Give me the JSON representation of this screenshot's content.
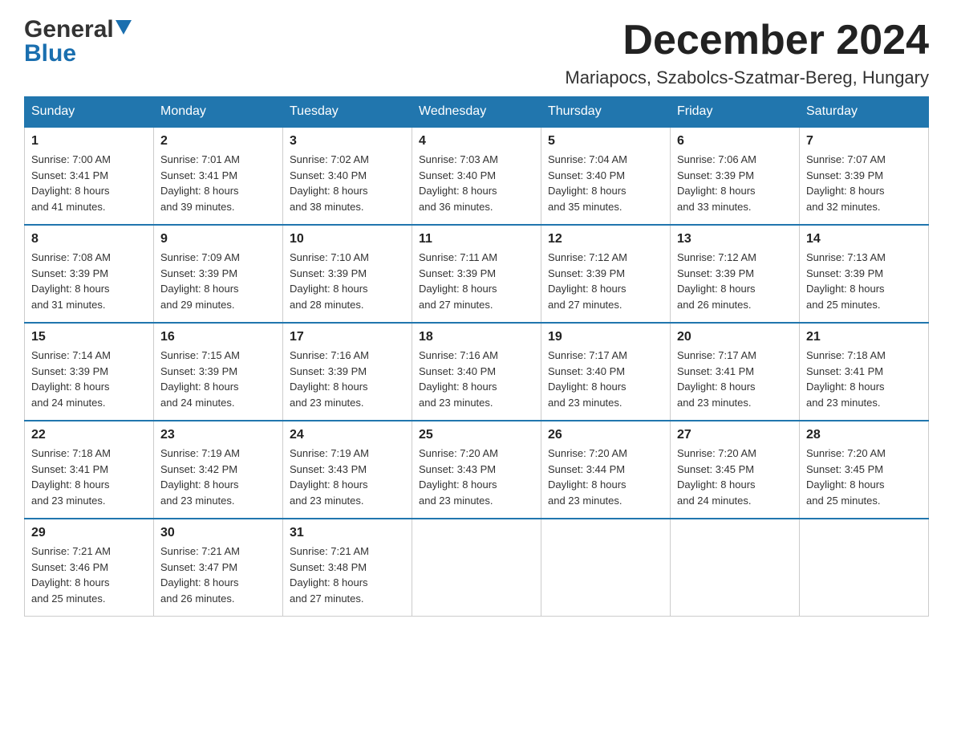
{
  "header": {
    "logo_general": "General",
    "logo_blue": "Blue",
    "month_title": "December 2024",
    "location": "Mariapocs, Szabolcs-Szatmar-Bereg, Hungary"
  },
  "days_of_week": [
    "Sunday",
    "Monday",
    "Tuesday",
    "Wednesday",
    "Thursday",
    "Friday",
    "Saturday"
  ],
  "weeks": [
    [
      {
        "day": "1",
        "sunrise": "7:00 AM",
        "sunset": "3:41 PM",
        "daylight": "8 hours and 41 minutes."
      },
      {
        "day": "2",
        "sunrise": "7:01 AM",
        "sunset": "3:41 PM",
        "daylight": "8 hours and 39 minutes."
      },
      {
        "day": "3",
        "sunrise": "7:02 AM",
        "sunset": "3:40 PM",
        "daylight": "8 hours and 38 minutes."
      },
      {
        "day": "4",
        "sunrise": "7:03 AM",
        "sunset": "3:40 PM",
        "daylight": "8 hours and 36 minutes."
      },
      {
        "day": "5",
        "sunrise": "7:04 AM",
        "sunset": "3:40 PM",
        "daylight": "8 hours and 35 minutes."
      },
      {
        "day": "6",
        "sunrise": "7:06 AM",
        "sunset": "3:39 PM",
        "daylight": "8 hours and 33 minutes."
      },
      {
        "day": "7",
        "sunrise": "7:07 AM",
        "sunset": "3:39 PM",
        "daylight": "8 hours and 32 minutes."
      }
    ],
    [
      {
        "day": "8",
        "sunrise": "7:08 AM",
        "sunset": "3:39 PM",
        "daylight": "8 hours and 31 minutes."
      },
      {
        "day": "9",
        "sunrise": "7:09 AM",
        "sunset": "3:39 PM",
        "daylight": "8 hours and 29 minutes."
      },
      {
        "day": "10",
        "sunrise": "7:10 AM",
        "sunset": "3:39 PM",
        "daylight": "8 hours and 28 minutes."
      },
      {
        "day": "11",
        "sunrise": "7:11 AM",
        "sunset": "3:39 PM",
        "daylight": "8 hours and 27 minutes."
      },
      {
        "day": "12",
        "sunrise": "7:12 AM",
        "sunset": "3:39 PM",
        "daylight": "8 hours and 27 minutes."
      },
      {
        "day": "13",
        "sunrise": "7:12 AM",
        "sunset": "3:39 PM",
        "daylight": "8 hours and 26 minutes."
      },
      {
        "day": "14",
        "sunrise": "7:13 AM",
        "sunset": "3:39 PM",
        "daylight": "8 hours and 25 minutes."
      }
    ],
    [
      {
        "day": "15",
        "sunrise": "7:14 AM",
        "sunset": "3:39 PM",
        "daylight": "8 hours and 24 minutes."
      },
      {
        "day": "16",
        "sunrise": "7:15 AM",
        "sunset": "3:39 PM",
        "daylight": "8 hours and 24 minutes."
      },
      {
        "day": "17",
        "sunrise": "7:16 AM",
        "sunset": "3:39 PM",
        "daylight": "8 hours and 23 minutes."
      },
      {
        "day": "18",
        "sunrise": "7:16 AM",
        "sunset": "3:40 PM",
        "daylight": "8 hours and 23 minutes."
      },
      {
        "day": "19",
        "sunrise": "7:17 AM",
        "sunset": "3:40 PM",
        "daylight": "8 hours and 23 minutes."
      },
      {
        "day": "20",
        "sunrise": "7:17 AM",
        "sunset": "3:41 PM",
        "daylight": "8 hours and 23 minutes."
      },
      {
        "day": "21",
        "sunrise": "7:18 AM",
        "sunset": "3:41 PM",
        "daylight": "8 hours and 23 minutes."
      }
    ],
    [
      {
        "day": "22",
        "sunrise": "7:18 AM",
        "sunset": "3:41 PM",
        "daylight": "8 hours and 23 minutes."
      },
      {
        "day": "23",
        "sunrise": "7:19 AM",
        "sunset": "3:42 PM",
        "daylight": "8 hours and 23 minutes."
      },
      {
        "day": "24",
        "sunrise": "7:19 AM",
        "sunset": "3:43 PM",
        "daylight": "8 hours and 23 minutes."
      },
      {
        "day": "25",
        "sunrise": "7:20 AM",
        "sunset": "3:43 PM",
        "daylight": "8 hours and 23 minutes."
      },
      {
        "day": "26",
        "sunrise": "7:20 AM",
        "sunset": "3:44 PM",
        "daylight": "8 hours and 23 minutes."
      },
      {
        "day": "27",
        "sunrise": "7:20 AM",
        "sunset": "3:45 PM",
        "daylight": "8 hours and 24 minutes."
      },
      {
        "day": "28",
        "sunrise": "7:20 AM",
        "sunset": "3:45 PM",
        "daylight": "8 hours and 25 minutes."
      }
    ],
    [
      {
        "day": "29",
        "sunrise": "7:21 AM",
        "sunset": "3:46 PM",
        "daylight": "8 hours and 25 minutes."
      },
      {
        "day": "30",
        "sunrise": "7:21 AM",
        "sunset": "3:47 PM",
        "daylight": "8 hours and 26 minutes."
      },
      {
        "day": "31",
        "sunrise": "7:21 AM",
        "sunset": "3:48 PM",
        "daylight": "8 hours and 27 minutes."
      },
      null,
      null,
      null,
      null
    ]
  ],
  "sunrise_label": "Sunrise:",
  "sunset_label": "Sunset:",
  "daylight_label": "Daylight:"
}
